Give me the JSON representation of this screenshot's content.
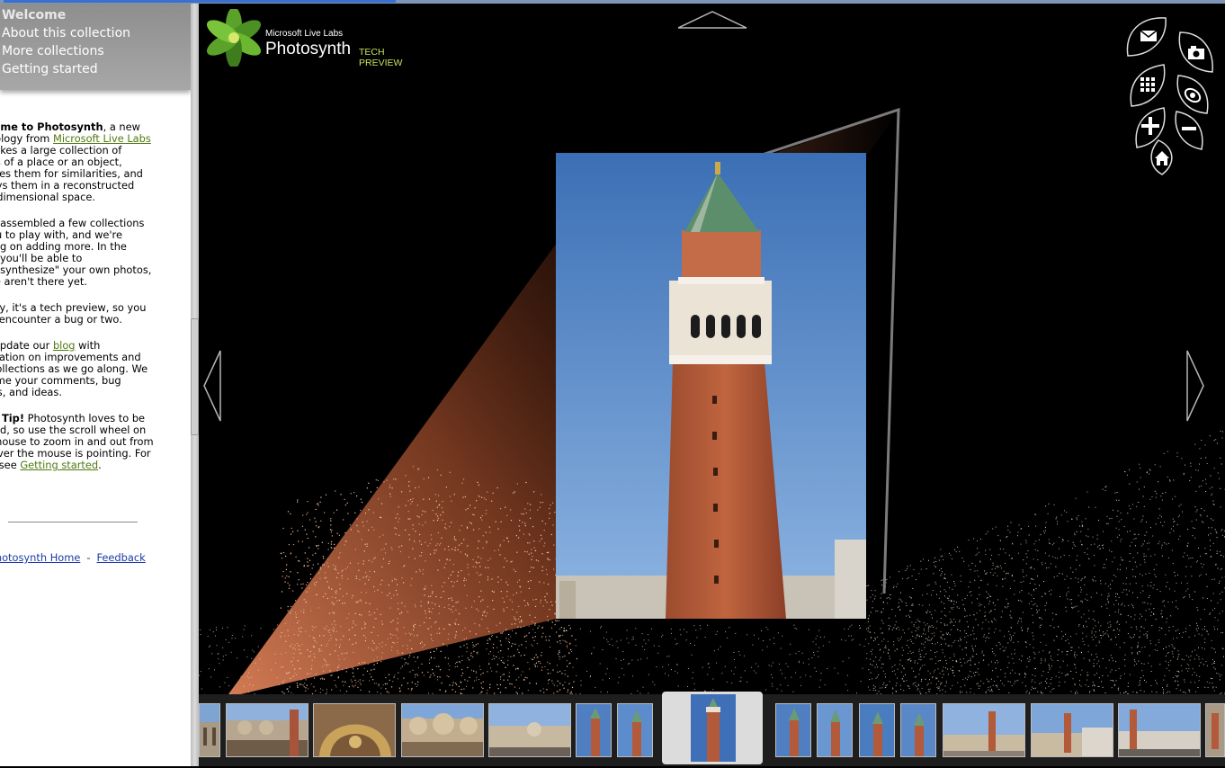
{
  "nav": {
    "items": [
      "Welcome",
      "About this collection",
      "More collections",
      "Getting started"
    ]
  },
  "sidebar": {
    "p1_bold": "Welcome to Photosynth",
    "p1_text1": ", a new",
    "p1_line2_pre": "technology from ",
    "p1_link": "Microsoft Live Labs",
    "p1_lines": [
      "that takes a large collection of",
      "photos of a place or an object,",
      "analyzes them for similarities, and",
      "displays them in a reconstructed",
      "three-dimensional space."
    ],
    "p2_lines": [
      "We've assembled a few collections",
      "for you to play with, and we're",
      "working on adding more. In the",
      "future you'll be able to",
      "\"photosynthesize\" your own photos,",
      "but we aren't there yet."
    ],
    "p3_lines": [
      "But hey, it's a tech preview, so you",
      "might encounter a bug or two."
    ],
    "p4_pre": "We'll update our ",
    "p4_link": "blog",
    "p4_post": " with",
    "p4_lines": [
      "information on improvements and",
      "new collections as we go along. We",
      "welcome your comments, bug",
      "reports, and ideas."
    ],
    "p5_bold": "Quick Tip!",
    "p5_text1": "  Photosynth loves to be",
    "p5_lines": [
      "zoomed, so use the scroll wheel on",
      "your mouse to zoom in and out from",
      "wherever the mouse is pointing. For",
      "more, see "
    ],
    "p5_link": "Getting started",
    "p5_end": ".",
    "footer_home": "Photosynth Home",
    "footer_sep": "-",
    "footer_feedback": "Feedback"
  },
  "logo": {
    "line1": "Microsoft Live Labs",
    "line2": "Photosynth",
    "line3": "TECH PREVIEW"
  },
  "controls": [
    "email-icon",
    "camera-icon",
    "grid-icon",
    "orbit-icon",
    "zoom-in-icon",
    "zoom-out-icon",
    "home-icon"
  ],
  "colors": {
    "accent_green": "#4f7a0e",
    "link_blue": "#1a3ca8",
    "tagline": "#c6e05a"
  }
}
